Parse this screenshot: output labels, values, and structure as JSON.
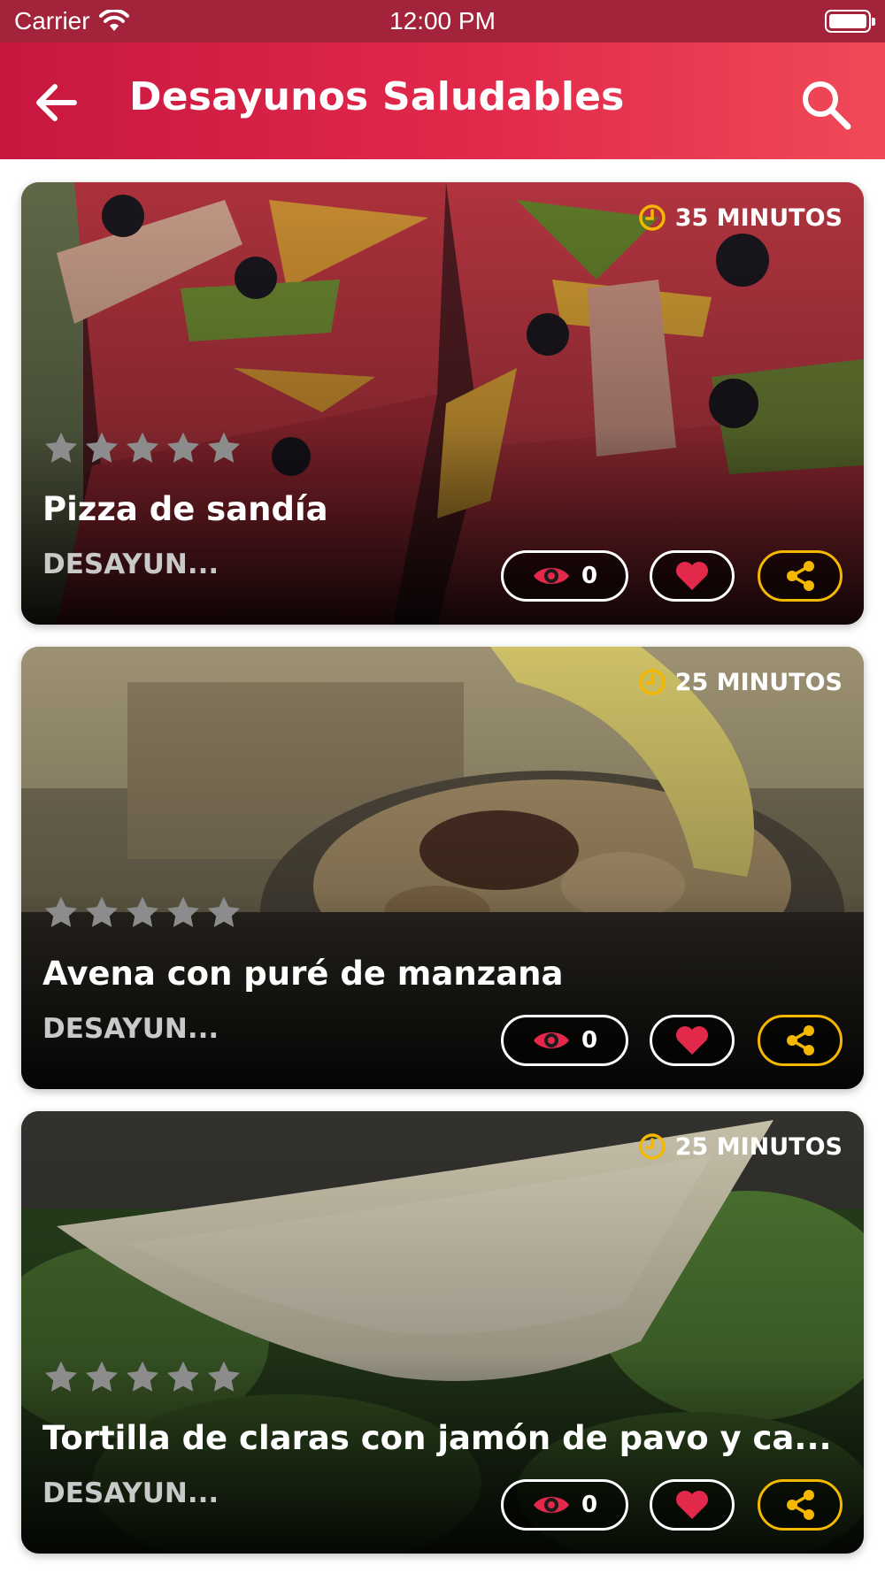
{
  "status_bar": {
    "carrier": "Carrier",
    "time": "12:00 PM"
  },
  "header": {
    "title": "Desayunos Saludables",
    "back_icon": "arrow-left-icon",
    "search_icon": "search-icon"
  },
  "colors": {
    "brand": "#e2294b",
    "clock": "#f5b800",
    "eye": "#e2294b",
    "heart": "#e2294b",
    "share": "#f5b800"
  },
  "recipes": [
    {
      "time": "35 MINUTOS",
      "rating": 5,
      "title": "Pizza de sandía",
      "category": "DESAYUN...",
      "views": "0"
    },
    {
      "time": "25 MINUTOS",
      "rating": 5,
      "title": "Avena con puré de manzana",
      "category": "DESAYUN...",
      "views": "0"
    },
    {
      "time": "25 MINUTOS",
      "rating": 5,
      "title": "Tortilla de claras con jamón de pavo y ca...",
      "category": "DESAYUN...",
      "views": "0"
    }
  ]
}
